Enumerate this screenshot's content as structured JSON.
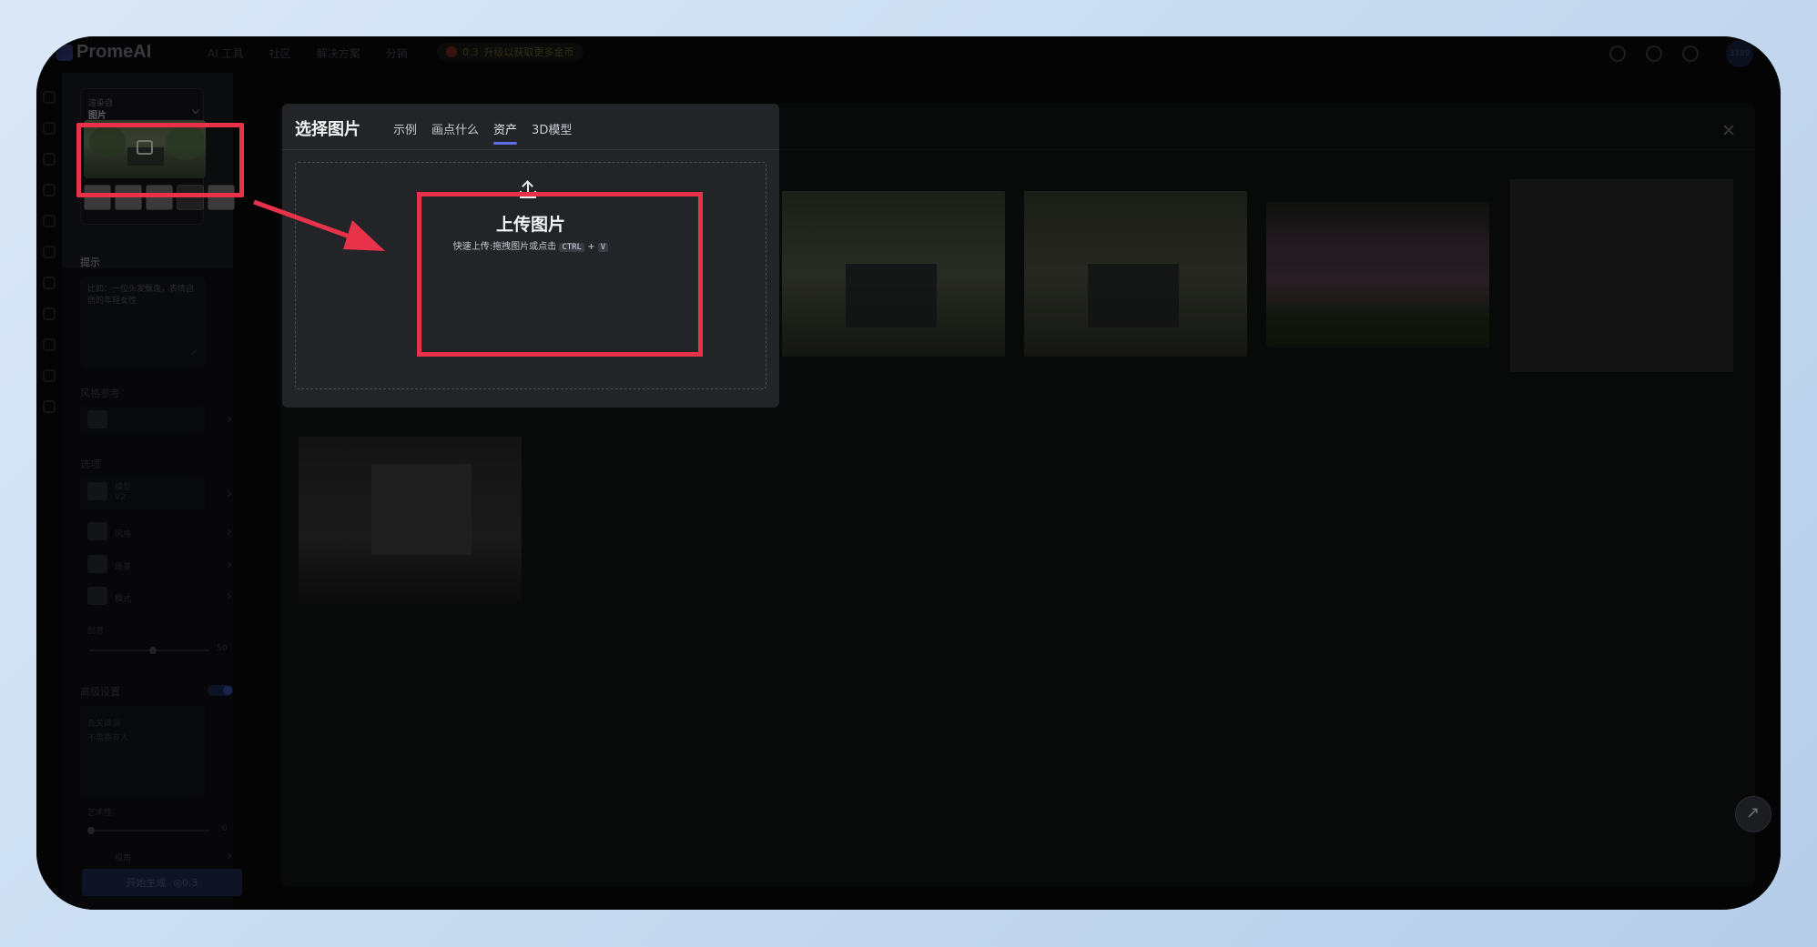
{
  "brand": {
    "name": "PromeAI"
  },
  "nav": {
    "items": [
      "AI 工具",
      "社区",
      "解决方案",
      "分销"
    ],
    "promo_count": "0.3",
    "promo_text": "升级以获取更多金币"
  },
  "account": {
    "avatar_label": "3189"
  },
  "left_panel": {
    "render_from_label": "渲染自",
    "render_from_value": "图片",
    "prompt_label": "提示",
    "prompt_placeholder": "比如：一位头发飘逸，表情自信的年轻女性",
    "style_ref_label": "风格参考",
    "options_label": "选项",
    "model_label": "模型",
    "model_value": "V2",
    "style_label": "风格",
    "scene_label": "场景",
    "mode_label": "模式",
    "creativity_label": "创意",
    "creativity_value": "50",
    "advanced_label": "高级设置",
    "negative_label": "负关键词",
    "negative_value": "不需要有人",
    "artistry_label": "艺术性",
    "artistry_value": "0",
    "view_label": "视角",
    "generate_label": "开始生成",
    "generate_cost": "0.3"
  },
  "modal": {
    "title": "选择图片",
    "tabs": [
      {
        "label": "示例",
        "active": false
      },
      {
        "label": "画点什么",
        "active": false
      },
      {
        "label": "资产",
        "active": true
      },
      {
        "label": "3D模型",
        "active": false
      }
    ],
    "upload_title": "上传图片",
    "upload_hint_prefix": "快速上传:拖拽图片或点击",
    "upload_key_1": "CTRL",
    "upload_key_plus": "+",
    "upload_key_2": "V"
  },
  "colors": {
    "highlight": "#e8324a",
    "accent": "#5d6ee6",
    "modal_bg": "#232428"
  }
}
